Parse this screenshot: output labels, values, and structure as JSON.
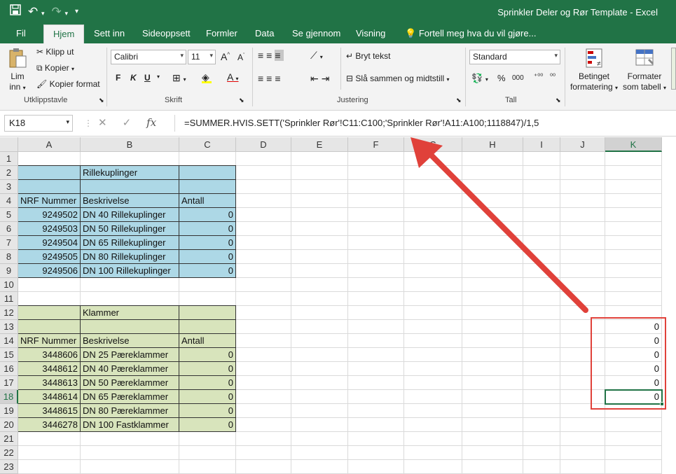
{
  "window": {
    "title": "Sprinkler Deler og Rør Template - Excel"
  },
  "qat": {
    "save_icon": "save-icon",
    "undo_icon": "undo-icon",
    "redo_icon": "redo-icon"
  },
  "tabs": [
    {
      "label": "Fil"
    },
    {
      "label": "Hjem"
    },
    {
      "label": "Sett inn"
    },
    {
      "label": "Sideoppsett"
    },
    {
      "label": "Formler"
    },
    {
      "label": "Data"
    },
    {
      "label": "Se gjennom"
    },
    {
      "label": "Visning"
    },
    {
      "label": "Fortell meg hva du vil gjøre..."
    }
  ],
  "ribbon": {
    "clipboard": {
      "paste": "Lim",
      "paste2": "inn",
      "cut": "Klipp ut",
      "copy": "Kopier",
      "format_painter": "Kopier format",
      "label": "Utklippstavle"
    },
    "font": {
      "family": "Calibri",
      "size": "11",
      "grow": "A",
      "shrink": "A",
      "bold": "F",
      "italic": "K",
      "underline": "U",
      "label": "Skrift"
    },
    "alignment": {
      "wrap": "Bryt tekst",
      "merge": "Slå sammen og midtstill",
      "label": "Justering"
    },
    "number": {
      "format": "Standard",
      "percent": "%",
      "thousands": "000",
      "label": "Tall"
    },
    "styles": {
      "conditional": "Betinget",
      "conditional2": "formatering",
      "as_table": "Formater",
      "as_table2": "som tabell"
    }
  },
  "formula_bar": {
    "name_box": "K18",
    "fx": "fx",
    "formula": "=SUMMER.HVIS.SETT('Sprinkler Rør'!C11:C100;'Sprinkler Rør'!A11:A100;1118847)/1,5"
  },
  "columns": [
    "A",
    "B",
    "C",
    "D",
    "E",
    "F",
    "G",
    "H",
    "I",
    "J",
    "K"
  ],
  "selected_column": "K",
  "selected_row": "18",
  "rows": [
    "1",
    "2",
    "3",
    "4",
    "5",
    "6",
    "7",
    "8",
    "9",
    "10",
    "11",
    "12",
    "13",
    "14",
    "15",
    "16",
    "17",
    "18",
    "19",
    "20",
    "21",
    "22",
    "23"
  ],
  "section1": {
    "title": "Rillekuplinger",
    "headers": [
      "NRF Nummer",
      "Beskrivelse",
      "Antall"
    ],
    "items": [
      {
        "nrf": "9249502",
        "desc": "DN 40 Rillekuplinger",
        "qty": "0"
      },
      {
        "nrf": "9249503",
        "desc": "DN 50 Rillekuplinger",
        "qty": "0"
      },
      {
        "nrf": "9249504",
        "desc": "DN 65 Rillekuplinger",
        "qty": "0"
      },
      {
        "nrf": "9249505",
        "desc": "DN 80 Rillekuplinger",
        "qty": "0"
      },
      {
        "nrf": "9249506",
        "desc": "DN 100 Rillekuplinger",
        "qty": "0"
      }
    ]
  },
  "section2": {
    "title": "Klammer",
    "headers": [
      "NRF Nummer",
      "Beskrivelse",
      "Antall"
    ],
    "items": [
      {
        "nrf": "3448606",
        "desc": "DN 25 Pæreklammer",
        "qty": "0"
      },
      {
        "nrf": "3448612",
        "desc": "DN 40 Pæreklammer",
        "qty": "0"
      },
      {
        "nrf": "3448613",
        "desc": "DN 50 Pæreklammer",
        "qty": "0"
      },
      {
        "nrf": "3448614",
        "desc": "DN 65 Pæreklammer",
        "qty": "0"
      },
      {
        "nrf": "3448615",
        "desc": "DN 80 Pæreklammer",
        "qty": "0"
      },
      {
        "nrf": "3446278",
        "desc": "DN 100 Fastklammer",
        "qty": "0"
      }
    ]
  },
  "column_k": [
    "0",
    "0",
    "0",
    "0",
    "0",
    "0"
  ],
  "colors": {
    "excel_green": "#217346",
    "blue_fill": "#add8e6",
    "green_fill": "#d8e4bc",
    "annotation_red": "#e0413a"
  }
}
